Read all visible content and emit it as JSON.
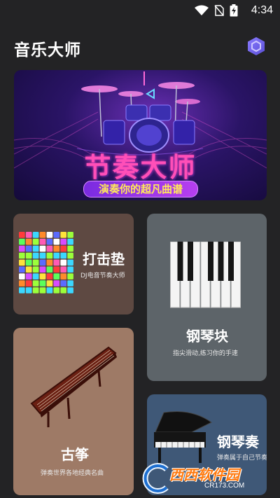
{
  "status": {
    "time": "4:34"
  },
  "header": {
    "title": "音乐大师"
  },
  "banner": {
    "title": "节奏大师",
    "subtitle": "演奏你的超凡曲谱"
  },
  "cards": {
    "drum_pad": {
      "title": "打击垫",
      "subtitle": "DJ电音节奏大师"
    },
    "piano_tiles": {
      "title": "钢琴块",
      "subtitle": "指尖滑动,练习你的手速"
    },
    "guzheng": {
      "title": "古筝",
      "subtitle": "弹奏世界各地经典名曲"
    },
    "piano_play": {
      "title": "钢琴奏",
      "subtitle": "弹奏属于自己节奏"
    }
  },
  "watermark": {
    "brand": "西西软件园",
    "url": "CR173.COM"
  },
  "colors": {
    "background": "#232325",
    "drum_card": "#5e4942",
    "piano_card": "#5d6469",
    "guzheng_card": "#9e7a66",
    "grand_card": "#3f5877"
  }
}
